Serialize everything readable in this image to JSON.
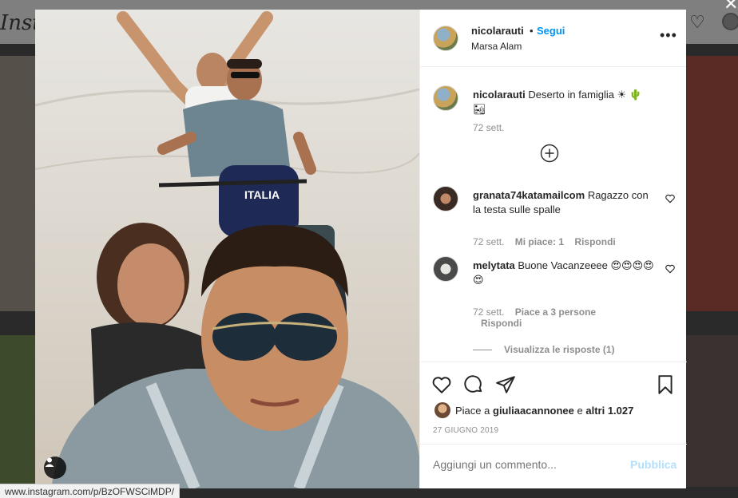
{
  "background": {
    "logo_text": "Insta"
  },
  "post": {
    "username": "nicolarauti",
    "separator": "•",
    "follow_label": "Segui",
    "location": "Marsa Alam",
    "more_icon": "more-horizontal-icon"
  },
  "caption": {
    "username": "nicolarauti",
    "text": "Deserto in famiglia ☀ 🌵🏜",
    "time": "72 sett."
  },
  "comments": [
    {
      "username": "granata74katamailcom",
      "text": "Ragazzo con la testa sulle spalle",
      "time": "72 sett.",
      "likes": "Mi piace: 1",
      "reply": "Rispondi"
    },
    {
      "username": "melytata",
      "text": "Buone Vacanzeeee 😍😍😍😍😍",
      "time": "72 sett.",
      "likes": "Piace a 3 persone",
      "reply": "Rispondi"
    }
  ],
  "view_replies": "Visualizza le risposte (1)",
  "likes_line": {
    "prefix": "Piace a",
    "user": "giuliaacannonee",
    "connector": "e",
    "others": "altri 1.027"
  },
  "post_date": "27 GIUGNO 2019",
  "add_comment": {
    "placeholder": "Aggiungi un commento...",
    "publish_label": "Pubblica"
  },
  "status_bar_url": "www.instagram.com/p/BzOFWSCiMDP/",
  "colors": {
    "link_blue": "#0095f6",
    "publish_disabled": "#b2dffc",
    "text": "#262626",
    "muted": "#8e8e8e"
  }
}
